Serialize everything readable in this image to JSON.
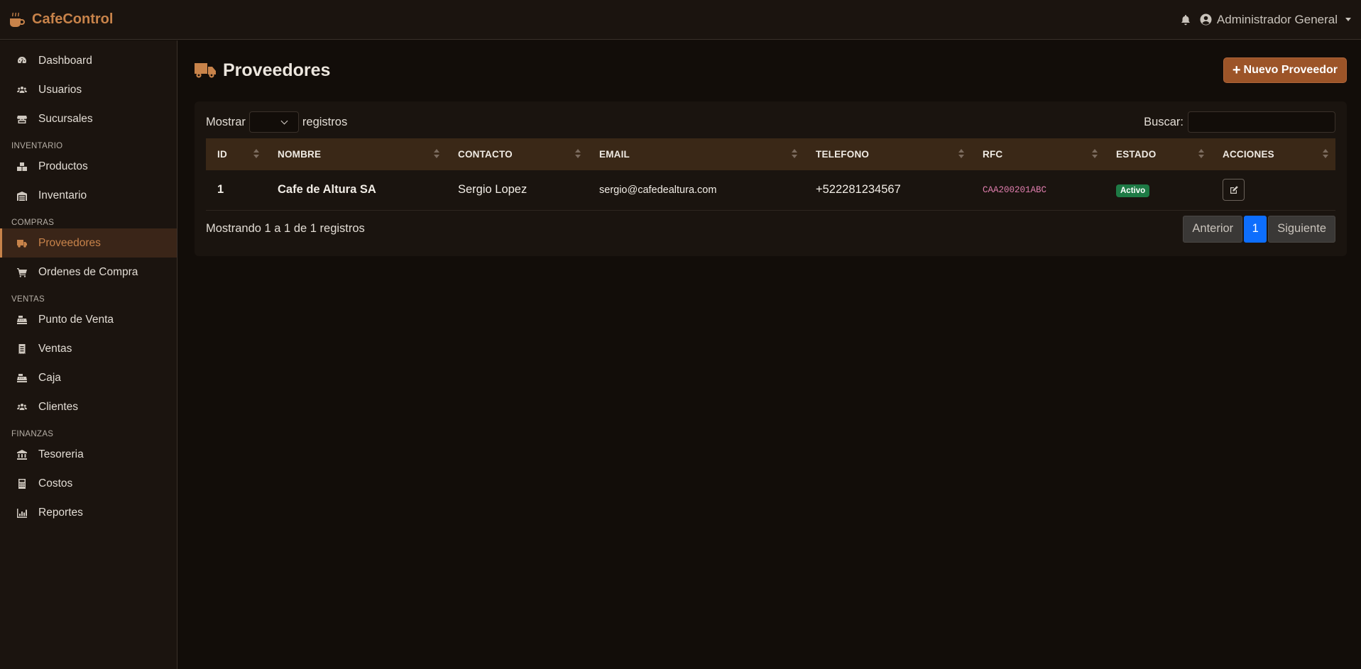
{
  "navbar": {
    "brand": "CafeControl",
    "user": "Administrador General"
  },
  "sidebar": {
    "items_top": [
      {
        "label": "Dashboard",
        "icon": "tachometer-icon"
      },
      {
        "label": "Usuarios",
        "icon": "users-icon"
      },
      {
        "label": "Sucursales",
        "icon": "store-icon"
      }
    ],
    "sections": [
      {
        "title": "INVENTARIO",
        "items": [
          {
            "label": "Productos",
            "icon": "boxes-icon"
          },
          {
            "label": "Inventario",
            "icon": "warehouse-icon"
          }
        ]
      },
      {
        "title": "COMPRAS",
        "items": [
          {
            "label": "Proveedores",
            "icon": "truck-icon",
            "active": true
          },
          {
            "label": "Ordenes de Compra",
            "icon": "cart-icon"
          }
        ]
      },
      {
        "title": "VENTAS",
        "items": [
          {
            "label": "Punto de Venta",
            "icon": "cash-register-icon"
          },
          {
            "label": "Ventas",
            "icon": "receipt-icon"
          },
          {
            "label": "Caja",
            "icon": "cash-register-icon"
          },
          {
            "label": "Clientes",
            "icon": "users-icon"
          }
        ]
      },
      {
        "title": "FINANZAS",
        "items": [
          {
            "label": "Tesoreria",
            "icon": "bank-icon"
          },
          {
            "label": "Costos",
            "icon": "calculator-icon"
          },
          {
            "label": "Reportes",
            "icon": "chart-bar-icon"
          }
        ]
      }
    ]
  },
  "page": {
    "title": "Proveedores",
    "new_button": "Nuevo Proveedor"
  },
  "table_controls": {
    "show_label": "Mostrar",
    "records_label": "registros",
    "search_label": "Buscar:",
    "search_value": ""
  },
  "table": {
    "columns": [
      "ID",
      "NOMBRE",
      "CONTACTO",
      "EMAIL",
      "TELEFONO",
      "RFC",
      "ESTADO",
      "ACCIONES"
    ],
    "rows": [
      {
        "id": "1",
        "nombre": "Cafe de Altura SA",
        "contacto": "Sergio Lopez",
        "email": "sergio@cafedealtura.com",
        "telefono": "+522281234567",
        "rfc": "CAA200201ABC",
        "estado": "Activo"
      }
    ]
  },
  "pagination": {
    "info": "Mostrando 1 a 1 de 1 registros",
    "prev": "Anterior",
    "current": "1",
    "next": "Siguiente"
  },
  "colors": {
    "accent": "#c8834a",
    "button": "#9c5428",
    "status_active": "#1e7a45",
    "page_current": "#0d6efd"
  }
}
